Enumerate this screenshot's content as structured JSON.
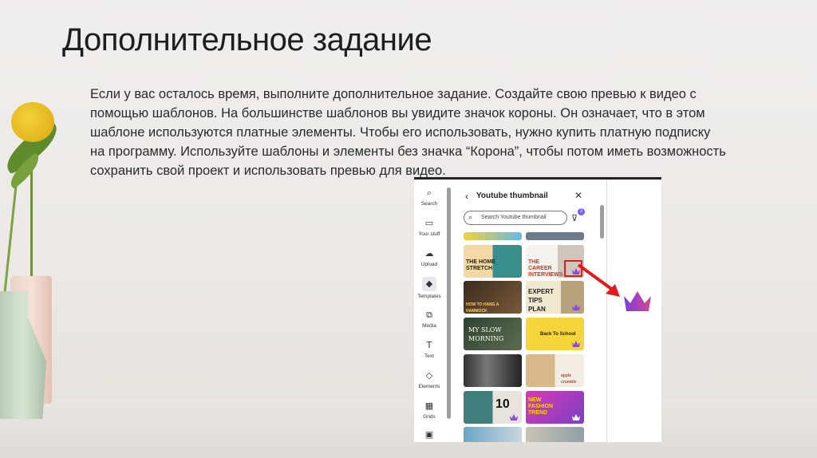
{
  "slide": {
    "title": "Дополнительное задание",
    "body": "Если у вас осталось время, выполните дополнительное задание. Создайте свою превью к видео с помощью шаблонов. На большинстве шаблонов вы увидите значок короны. Он означает, что в этом шаблоне используются платные элементы. Чтобы его использовать, нужно купить платную подписку на программу. Используйте шаблоны и элементы без значка “Корона”, чтобы потом иметь возможность сохранить свой проект и использовать превью для видео."
  },
  "sidebar": {
    "items": [
      {
        "label": "Search",
        "icon": "search-icon"
      },
      {
        "label": "Your stuff",
        "icon": "folder-icon"
      },
      {
        "label": "Upload",
        "icon": "upload-icon"
      },
      {
        "label": "Templates",
        "icon": "templates-icon",
        "active": true
      },
      {
        "label": "Media",
        "icon": "media-icon"
      },
      {
        "label": "Text",
        "icon": "text-icon"
      },
      {
        "label": "Elements",
        "icon": "elements-icon"
      },
      {
        "label": "Grids",
        "icon": "grids-icon"
      }
    ]
  },
  "panel": {
    "title": "Youtube thumbnail",
    "search_placeholder": "Search Youtube thumbnail",
    "filter_count": "2"
  },
  "thumbnails": [
    {
      "text": "THE HOME STRETCH",
      "crown": false
    },
    {
      "text": "THE CAREER INTERVIEWS",
      "crown": true
    },
    {
      "text": "HOW TO HANG A HAMMOCK",
      "crown": false
    },
    {
      "text": "EXPERT TIPS PLAN",
      "crown": true
    },
    {
      "text": "MY SLOW MORNING",
      "crown": false
    },
    {
      "text": "Back To School",
      "crown": true
    },
    {
      "text": "",
      "crown": false
    },
    {
      "text": "apple crumble",
      "crown": false
    },
    {
      "text": "10",
      "crown": true
    },
    {
      "text": "NEW FASHION TREND",
      "crown": true
    }
  ],
  "colors": {
    "crown": "#8a4dd6",
    "arrow": "#e21b1b",
    "accent": "#7a5af8"
  }
}
